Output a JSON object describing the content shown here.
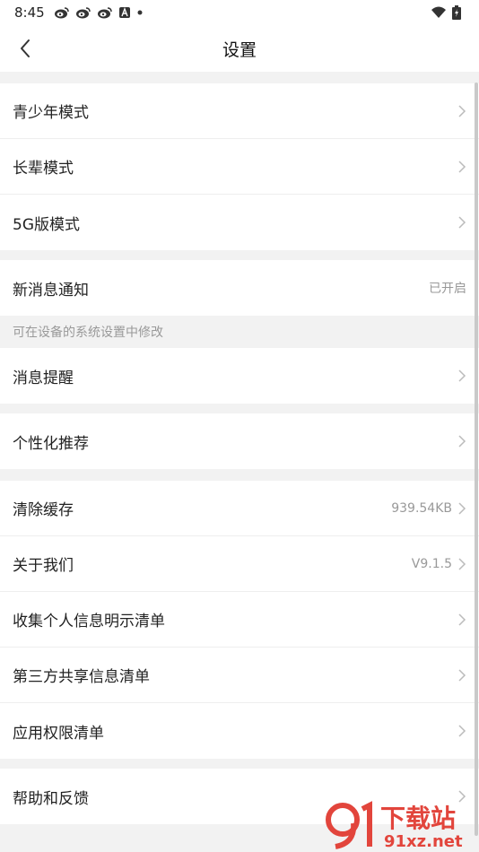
{
  "status_bar": {
    "time": "8:45",
    "left_icons": [
      "weibo-icon",
      "weibo-icon",
      "weibo-icon",
      "a-app-icon",
      "dot-icon"
    ],
    "right_icons": [
      "wifi-icon",
      "battery-charging-icon"
    ]
  },
  "nav": {
    "back_icon": "chevron-left-icon",
    "title": "设置"
  },
  "groups": [
    {
      "rows": [
        {
          "label": "青少年模式",
          "value": "",
          "arrow": true
        },
        {
          "label": "长辈模式",
          "value": "",
          "arrow": true
        },
        {
          "label": "5G版模式",
          "value": "",
          "arrow": true
        }
      ]
    },
    {
      "rows": [
        {
          "label": "新消息通知",
          "value": "已开启",
          "arrow": false
        }
      ]
    },
    {
      "hint": "可在设备的系统设置中修改"
    },
    {
      "rows": [
        {
          "label": "消息提醒",
          "value": "",
          "arrow": true
        }
      ]
    },
    {
      "rows": [
        {
          "label": "个性化推荐",
          "value": "",
          "arrow": true
        }
      ]
    },
    {
      "rows": [
        {
          "label": "清除缓存",
          "value": "939.54KB",
          "arrow": true
        },
        {
          "label": "关于我们",
          "value": "V9.1.5",
          "arrow": true
        },
        {
          "label": "收集个人信息明示清单",
          "value": "",
          "arrow": true
        },
        {
          "label": "第三方共享信息清单",
          "value": "",
          "arrow": true
        },
        {
          "label": "应用权限清单",
          "value": "",
          "arrow": true
        }
      ]
    },
    {
      "rows": [
        {
          "label": "帮助和反馈",
          "value": "",
          "arrow": true
        }
      ]
    }
  ],
  "watermark": {
    "brand": "下载站",
    "url": "91xz.net"
  },
  "colors": {
    "background": "#f2f2f2",
    "card": "#ffffff",
    "text": "#222222",
    "secondary": "#999999",
    "watermark_red": "#e2453c"
  }
}
